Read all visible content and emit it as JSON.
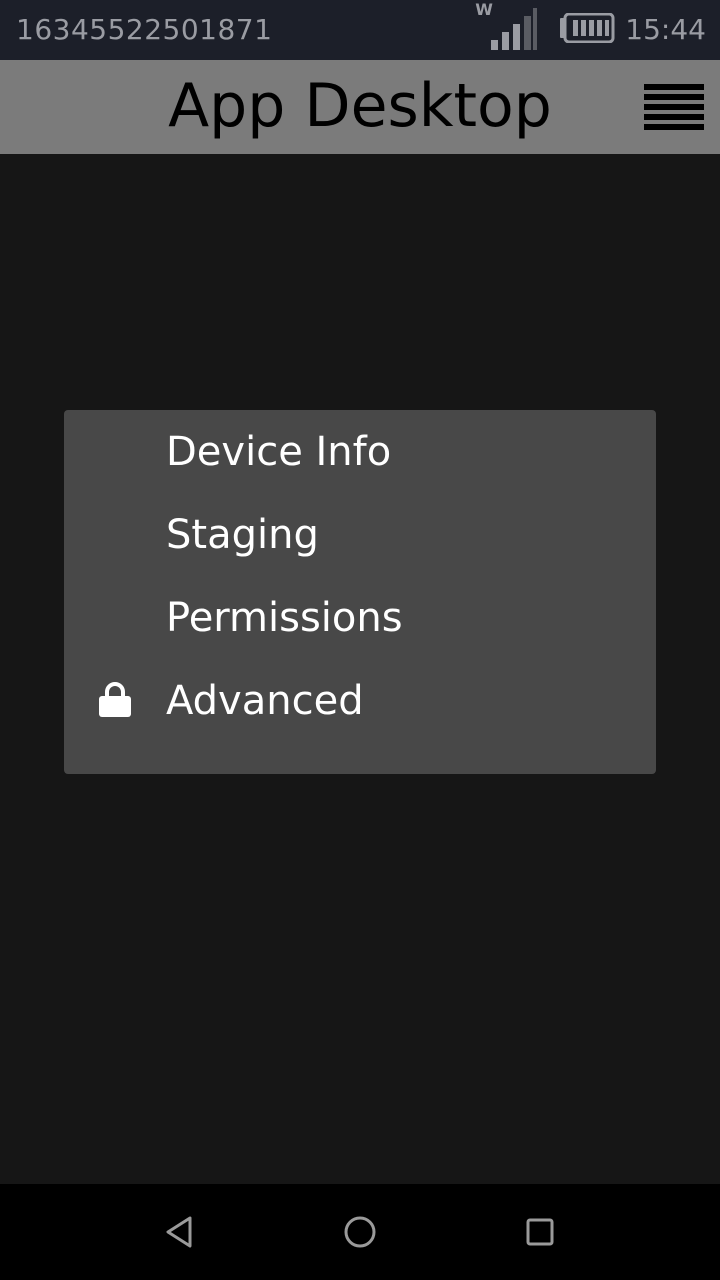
{
  "status_bar": {
    "device_id": "16345522501871",
    "network_type": "W",
    "time": "15:44",
    "icons": [
      "signal-icon",
      "battery-icon"
    ]
  },
  "app_bar": {
    "title": "App Desktop",
    "menu_icon": "hamburger-menu-icon"
  },
  "popup_menu": {
    "items": [
      {
        "label": "Device Info",
        "icon": null
      },
      {
        "label": "Staging",
        "icon": null
      },
      {
        "label": "Permissions",
        "icon": null
      },
      {
        "label": "Advanced",
        "icon": "lock-icon"
      }
    ]
  },
  "nav_bar": {
    "buttons": [
      "back-icon",
      "home-icon",
      "recent-apps-icon"
    ]
  },
  "colors": {
    "status_bar_bg": "#1c1f29",
    "app_bar_bg": "#7b7b7b",
    "content_bg": "#161616",
    "menu_bg": "#484848",
    "nav_bar_bg": "#000000"
  }
}
